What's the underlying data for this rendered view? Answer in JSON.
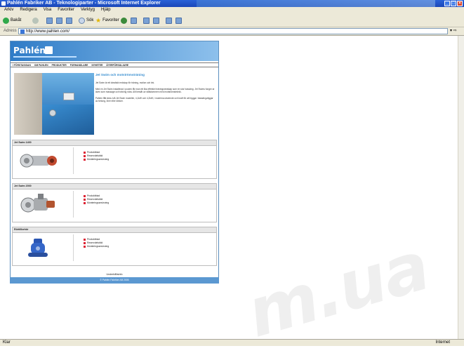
{
  "window": {
    "title": "Pahlén Fabriker AB - Teknologiparter - Microsoft Internet Explorer"
  },
  "menu": [
    "Arkiv",
    "Redigera",
    "Visa",
    "Favoriter",
    "Verktyg",
    "Hjälp"
  ],
  "toolbar": {
    "back": "Bakåt",
    "search": "Sök",
    "favorites": "Favoriter"
  },
  "address": {
    "label": "Adress",
    "url": "http://www.pahlen.com/"
  },
  "site": {
    "logo": "Pahlén",
    "nav": [
      "I FÖRSTASIDAN",
      "OM PAHLEN",
      "PRODUKTER",
      "FORHANDLARE",
      "NYHETER",
      "ÅTERFÖRSÄLJARE"
    ],
    "hero": {
      "title": "Jet Swim och motströmsträning",
      "paragraphs": [
        "Jet Swim är ett idealiskt redskap för träning, motion och lek.",
        "Med en Jet Swim installerad i poolen får man ett lika effektivt träningsredskap som en stor bassäng. Jet Swims funger ar även som massage och träning nära. Allt består av stålstommen med motströmsteknik.",
        "Pahlen fått ännu två Jet Swim modeller, 4,1kW och 4,2kW, i moderna utseende och kraft för att bygga i bassängväggar av betong, liner eller klinker."
      ]
    },
    "sections": [
      {
        "title": "Jet Swim 1400",
        "links": [
          "Produktblad",
          "Reservdelsbild",
          "Monteringsanvisning"
        ]
      },
      {
        "title": "Jet Swim 2000",
        "links": [
          "Produktblad",
          "Reservdelsbild",
          "Monteringsanvisning"
        ]
      },
      {
        "title": "Rörtillbehör",
        "links": [
          "Produktblad",
          "Reservdelsbild",
          "Monteringsanvisning"
        ]
      }
    ],
    "footer_link": "Underhållsinfo",
    "copyright": "© Pahlén Fabriker AB 2005"
  },
  "status": {
    "text": "Klar",
    "zone": "Internet"
  },
  "watermark": "m.ua"
}
